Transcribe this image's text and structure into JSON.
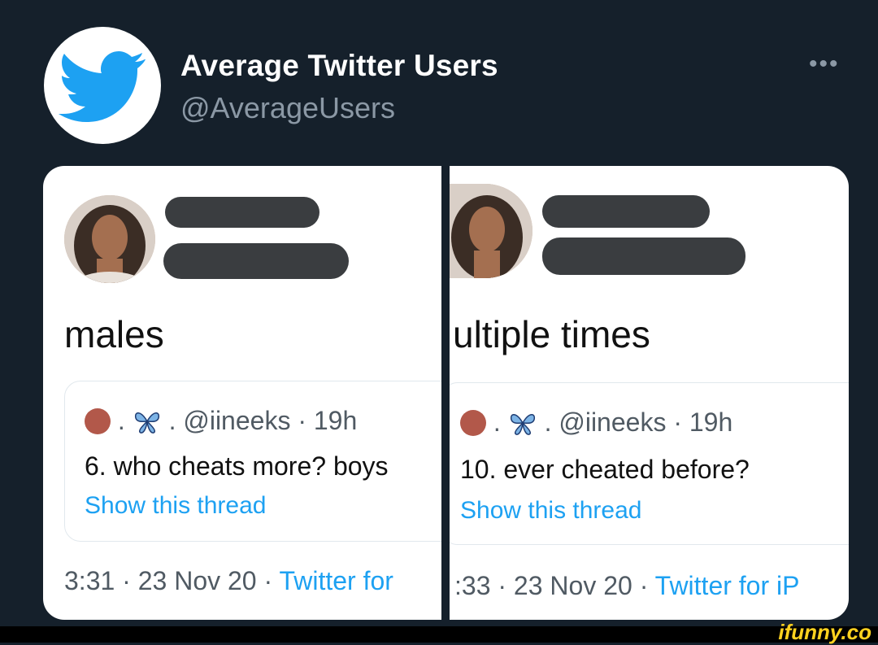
{
  "header": {
    "name": "Average Twitter Users",
    "handle": "@AverageUsers",
    "more": "•••",
    "avatar_icon": "twitter-bird-icon"
  },
  "left": {
    "tweet_text": "males",
    "quote": {
      "sep1": ".",
      "sep2": ".",
      "meta": "@iineeks · 19h",
      "text": "6. who cheats more? boys",
      "link": "Show this thread"
    },
    "time": "3:31 · 23 Nov 20 · ",
    "source": "Twitter for"
  },
  "right": {
    "tweet_text": "ultiple times",
    "quote": {
      "sep1": ".",
      "sep2": ".",
      "meta": "@iineeks · 19h",
      "text": "10. ever cheated before?",
      "link": "Show this thread"
    },
    "time": ":33 · 23 Nov 20 · ",
    "source": "Twitter for iP"
  },
  "watermark": "ifunny.co",
  "colors": {
    "background": "#15202b",
    "link": "#1da1f2",
    "brand": "#1da1f2",
    "watermark": "#ffd21f"
  }
}
